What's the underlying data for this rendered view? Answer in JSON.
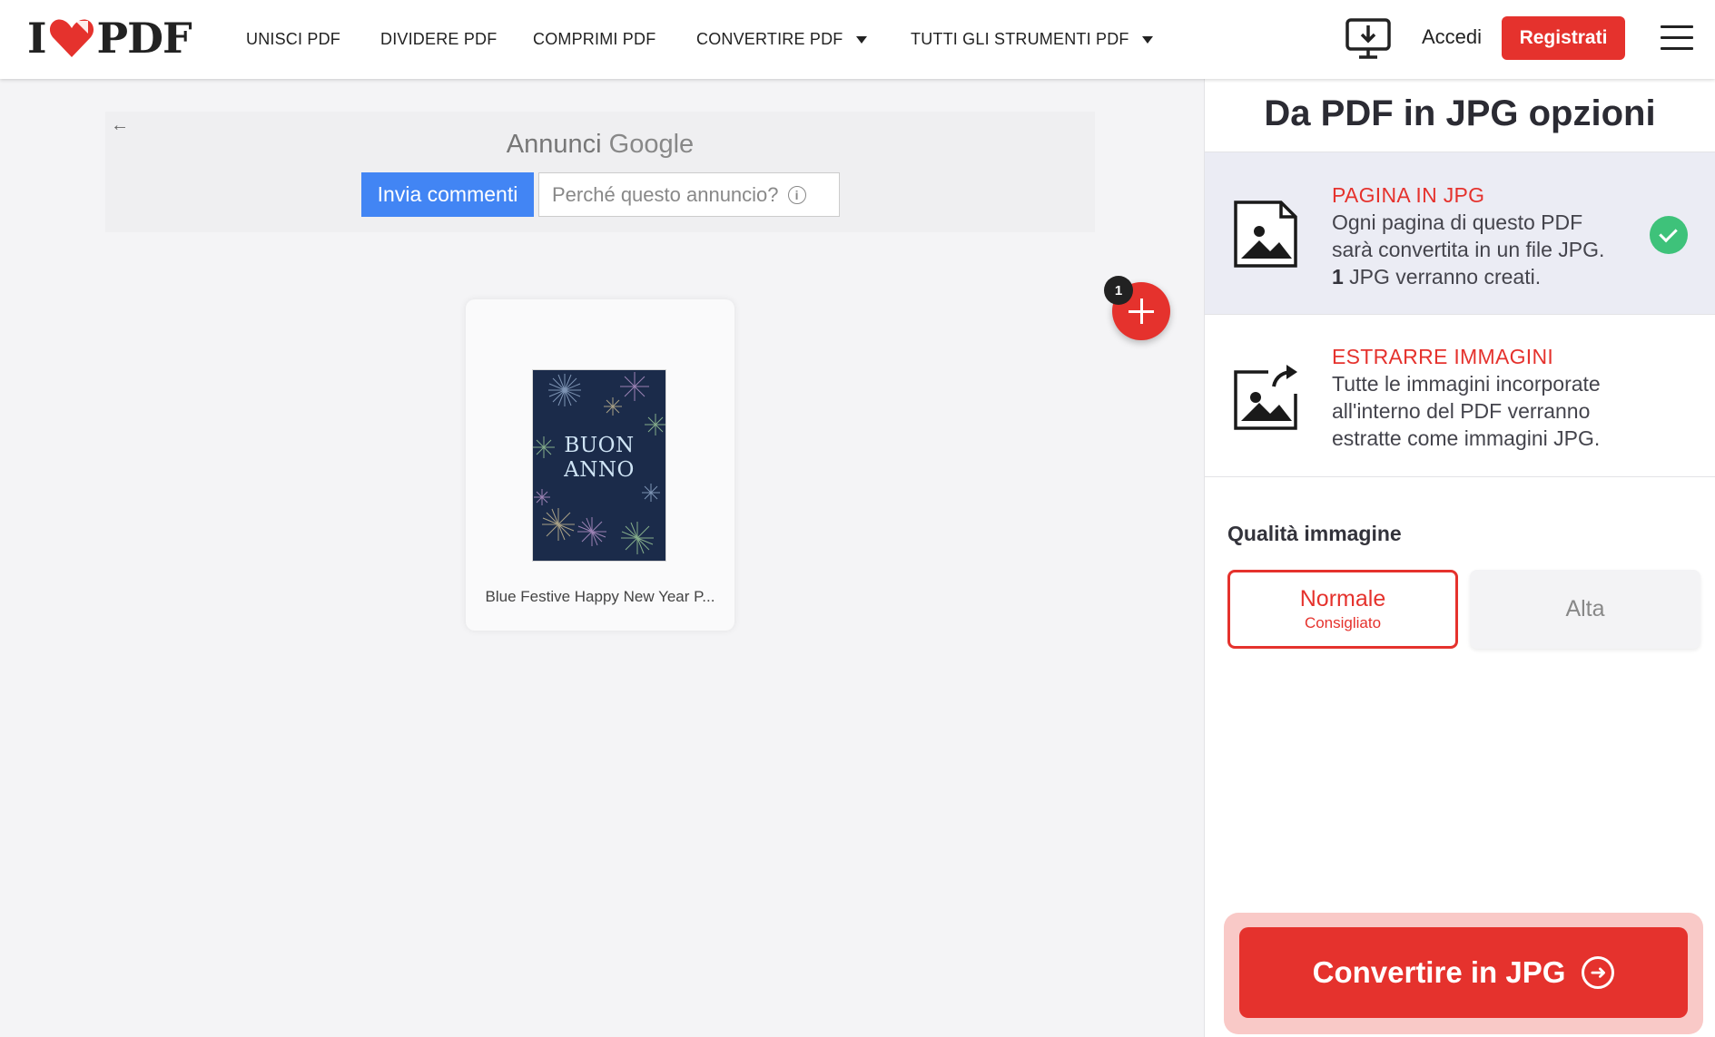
{
  "brand": {
    "logo_left": "I",
    "logo_right": "PDF",
    "accent": "#e5322d"
  },
  "nav": {
    "merge": "UNISCI PDF",
    "split": "DIVIDERE PDF",
    "compress": "COMPRIMI PDF",
    "convert": "CONVERTIRE PDF",
    "all_tools": "TUTTI GLI STRUMENTI PDF"
  },
  "header": {
    "login": "Accedi",
    "signup": "Registrati"
  },
  "ad": {
    "prefix": "Annunci",
    "brand": "Google",
    "send_feedback": "Invia commenti",
    "why_ad": "Perché questo annuncio?",
    "info_glyph": "i"
  },
  "file": {
    "name": "Blue Festive Happy New Year P...",
    "thumb_line1": "BUON",
    "thumb_line2": "ANNO",
    "count": "1"
  },
  "sidebar": {
    "title": "Da PDF in JPG opzioni",
    "options": [
      {
        "title": "PAGINA IN JPG",
        "desc_line1": "Ogni pagina di questo PDF",
        "desc_line2": "sarà convertita in un file JPG.",
        "desc_count": "1",
        "desc_line3": " JPG verranno creati.",
        "selected": true
      },
      {
        "title": "ESTRARRE IMMAGINI",
        "desc_line1": "Tutte le immagini incorporate",
        "desc_line2": "all'interno del PDF verranno",
        "desc_line3": "estratte come immagini JPG.",
        "selected": false
      }
    ],
    "quality_label": "Qualità immagine",
    "quality": {
      "normal": "Normale",
      "normal_sub": "Consigliato",
      "high": "Alta",
      "selected": "Normale"
    },
    "convert_button": "Convertire in JPG"
  },
  "colors": {
    "accent": "#e5322d",
    "selected_bg": "#ebecf4",
    "check": "#3ec27a",
    "google_blue": "#4285f4"
  }
}
